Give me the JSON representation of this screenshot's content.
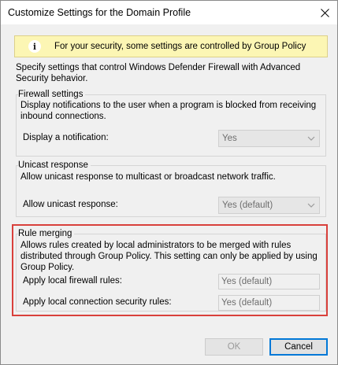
{
  "window": {
    "title": "Customize Settings for the Domain Profile",
    "close_icon": "close-icon"
  },
  "banner": {
    "icon": "info-icon",
    "icon_glyph": "i",
    "text": "For your security, some settings are controlled by Group Policy",
    "bg_color": "#fcf6b4"
  },
  "intro_text": "Specify settings that control Windows Defender Firewall with Advanced Security behavior.",
  "firewall_settings": {
    "title": "Firewall settings",
    "description": "Display notifications to the user when a program is blocked from receiving inbound connections.",
    "notification_label": "Display a notification:",
    "notification_value": "Yes"
  },
  "unicast_response": {
    "title": "Unicast response",
    "description": "Allow unicast response to multicast or broadcast network traffic.",
    "label": "Allow unicast response:",
    "value": "Yes (default)"
  },
  "rule_merging": {
    "title": "Rule merging",
    "description": "Allows rules created by local administrators to be merged with rules distributed through Group Policy. This setting can only be applied by using Group Policy.",
    "firewall_rules_label": "Apply local firewall rules:",
    "firewall_rules_value": "Yes (default)",
    "connection_rules_label": "Apply local connection security rules:",
    "connection_rules_value": "Yes (default)",
    "highlight_color": "#d9403b"
  },
  "buttons": {
    "ok": "OK",
    "cancel": "Cancel",
    "accent": "#0078d7"
  }
}
